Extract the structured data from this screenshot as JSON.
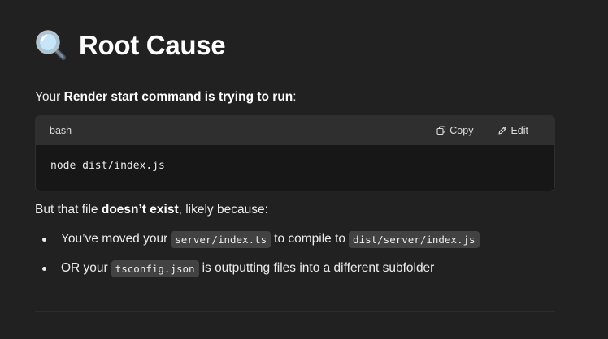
{
  "heading": {
    "icon": "magnifying-glass-icon",
    "text": "Root Cause"
  },
  "intro": {
    "prefix": "Your ",
    "bold": "Render start command is trying to run",
    "suffix": ":"
  },
  "codeblock": {
    "language": "bash",
    "copy_label": "Copy",
    "edit_label": "Edit",
    "code": "node dist/index.js"
  },
  "after": {
    "prefix": "But that file ",
    "bold": "doesn’t exist",
    "suffix": ", likely because:"
  },
  "bullets": [
    {
      "text_before": "You’ve moved your",
      "code1": "server/index.ts",
      "text_middle": "to compile to",
      "code2": "dist/server/index.js"
    },
    {
      "text_before": "OR your",
      "code1": "tsconfig.json",
      "text_after": "is outputting files into a different subfolder"
    }
  ],
  "colors": {
    "background": "#212121",
    "text": "#ececec",
    "code_bg": "#171717",
    "code_header_bg": "#2f2f2f",
    "inline_code_bg": "#424242"
  }
}
